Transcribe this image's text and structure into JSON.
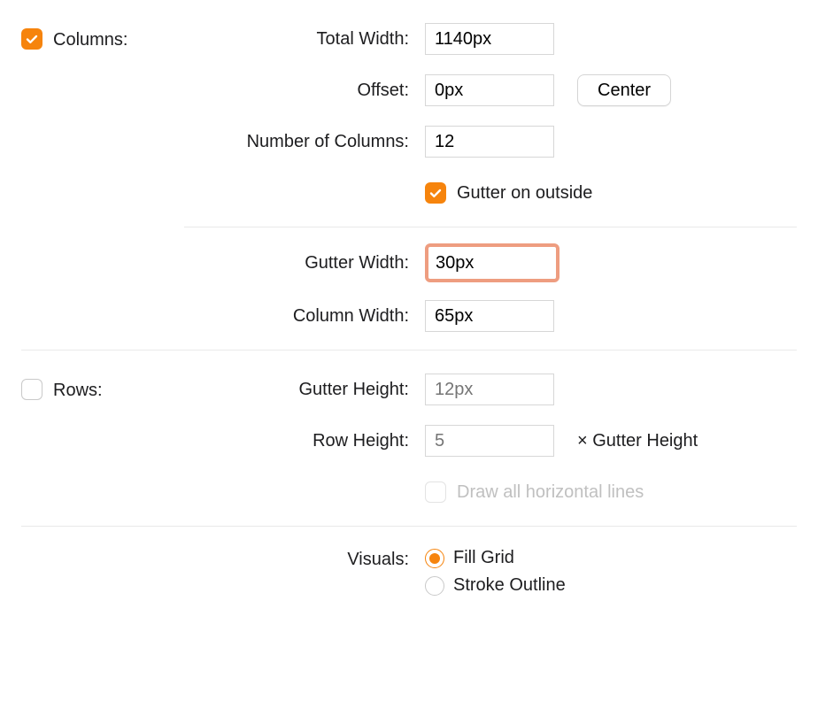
{
  "columns": {
    "section_label": "Columns:",
    "total_width_label": "Total Width:",
    "total_width_value": "1140px",
    "offset_label": "Offset:",
    "offset_value": "0px",
    "center_button": "Center",
    "number_of_columns_label": "Number of Columns:",
    "number_of_columns_value": "12",
    "gutter_outside_label": "Gutter on outside",
    "gutter_width_label": "Gutter Width:",
    "gutter_width_value": "30px",
    "column_width_label": "Column Width:",
    "column_width_value": "65px"
  },
  "rows": {
    "section_label": "Rows:",
    "gutter_height_label": "Gutter Height:",
    "gutter_height_placeholder": "12px",
    "row_height_label": "Row Height:",
    "row_height_placeholder": "5",
    "row_height_suffix": "× Gutter Height",
    "draw_lines_label": "Draw all horizontal lines"
  },
  "visuals": {
    "label": "Visuals:",
    "fill_grid": "Fill Grid",
    "stroke_outline": "Stroke Outline"
  }
}
